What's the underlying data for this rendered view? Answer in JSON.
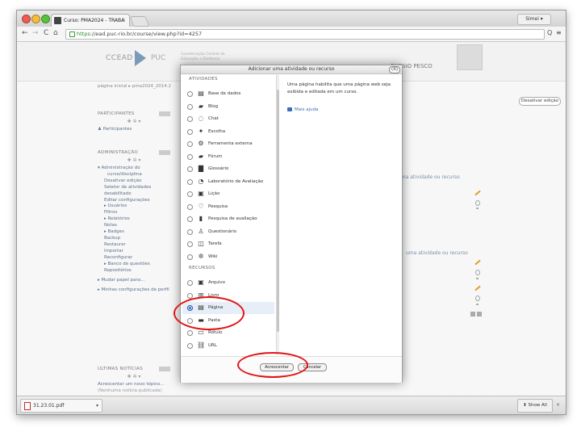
{
  "browser": {
    "tab_title": "Curso: PMA2024 - TRABA",
    "tab_close": "×",
    "user_button": "Simei ▾",
    "url_scheme": "https",
    "url_rest": "://ead.puc-rio.br/course/view.php?id=4257",
    "nav": {
      "back": "←",
      "forward": "→",
      "reload": "C",
      "home": "⌂"
    },
    "star": "☆",
    "menu": "≡",
    "search": "Q"
  },
  "moodle": {
    "logo_text": "CCEAD",
    "logo_puc": "PUC",
    "logo_sub": "Coordenação Central de Educação a Distância",
    "user_name": "ENESIO PESCO",
    "breadcrumb": "página inicial  ▸  pma2024_2014.2",
    "edit_button": "Desativar edição",
    "participants_title": "PARTICIPANTES",
    "participants_link": "Participantes",
    "admin_title": "ADMINISTRAÇÃO",
    "admin_items": [
      "▾ Administração do",
      "curso/disciplina",
      "Desativar edição",
      "Seletor de atividades",
      "desabilitado",
      "Editar configurações",
      "▸ Usuários",
      "Filtros",
      "▸ Relatórios",
      "Notas",
      "▸ Badges",
      "Backup",
      "Restaurar",
      "Importar",
      "Reconfigurar",
      "▸ Banco de questões",
      "Repositórios"
    ],
    "role_switch": "▸ Mudar papel para...",
    "profile_settings": "▸ Minhas configurações de perfil",
    "news_title": "ÚLTIMAS NOTÍCIAS",
    "news_add": "Acrescentar um novo tópico...",
    "news_empty": "(Nenhuma notícia publicada)",
    "add_activity_1": "uma atividade ou recurso",
    "add_activity_2": "uma atividade ou recurso"
  },
  "modal": {
    "title": "Adicionar uma atividade ou recurso",
    "close": "(X)",
    "section_activities": "ATIVIDADES",
    "activities": [
      {
        "icon": "database-icon",
        "glyph": "▤",
        "label": "Base de dados"
      },
      {
        "icon": "blog-icon",
        "glyph": "▰",
        "label": "Blog"
      },
      {
        "icon": "chat-icon",
        "glyph": "◌",
        "label": "Chat"
      },
      {
        "icon": "choice-icon",
        "glyph": "✦",
        "label": "Escolha"
      },
      {
        "icon": "external-tool-icon",
        "glyph": "⚙",
        "label": "Ferramenta externa"
      },
      {
        "icon": "forum-icon",
        "glyph": "▰",
        "label": "Fórum"
      },
      {
        "icon": "glossary-icon",
        "glyph": "▇",
        "label": "Glossário"
      },
      {
        "icon": "evaluation-lab-icon",
        "glyph": "◔",
        "label": "Laboratório de Avaliação"
      },
      {
        "icon": "lesson-icon",
        "glyph": "▣",
        "label": "Lição"
      },
      {
        "icon": "survey-icon",
        "glyph": "♡",
        "label": "Pesquisa"
      },
      {
        "icon": "evaluation-survey-icon",
        "glyph": "▮",
        "label": "Pesquisa de avaliação"
      },
      {
        "icon": "quiz-icon",
        "glyph": "♙",
        "label": "Questionário"
      },
      {
        "icon": "assignment-icon",
        "glyph": "◫",
        "label": "Tarefa"
      },
      {
        "icon": "wiki-icon",
        "glyph": "✲",
        "label": "Wiki"
      }
    ],
    "section_resources": "RECURSOS",
    "resources": [
      {
        "icon": "file-icon",
        "glyph": "▣",
        "label": "Arquivo"
      },
      {
        "icon": "book-icon",
        "glyph": "▥",
        "label": "Livro"
      },
      {
        "icon": "page-icon",
        "glyph": "▤",
        "label": "Página"
      },
      {
        "icon": "folder-icon",
        "glyph": "▬",
        "label": "Pasta"
      },
      {
        "icon": "label-icon",
        "glyph": "▭",
        "label": "Rótulo"
      },
      {
        "icon": "url-icon",
        "glyph": "⛓",
        "label": "URL"
      }
    ],
    "selected": "Página",
    "description": "Uma página habilita que uma página web seja exibida e editada em um curso.",
    "help": "Mais ajuda",
    "add_button": "Acrescentar",
    "cancel_button": "Cancelar"
  },
  "downloads": {
    "file_name": "31.23.01.pdf",
    "arrow": "▾",
    "show_all": "Show All",
    "close": "×"
  },
  "colors": {
    "annotation": "#e01515",
    "selected_radio": "#2f6ad0",
    "link": "#5a6f8c"
  }
}
